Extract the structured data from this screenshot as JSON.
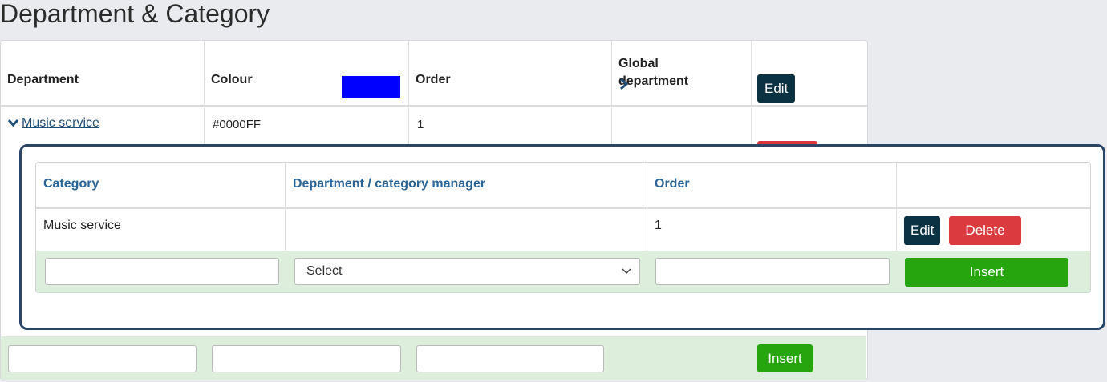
{
  "page": {
    "title": "Department & Category"
  },
  "departments_table": {
    "headers": {
      "department": "Department",
      "colour": "Colour",
      "order": "Order",
      "global_department_line1": "Global",
      "global_department_line2": "department"
    },
    "row": {
      "department": "Music service",
      "colour_hex": "#0000FF",
      "order": "1",
      "edit_label": "Edit"
    },
    "insert_label": "Insert"
  },
  "category_panel": {
    "headers": {
      "category": "Category",
      "manager": "Department / category manager",
      "order": "Order"
    },
    "row": {
      "category": "Music service",
      "manager": "",
      "order": "1",
      "edit_label": "Edit",
      "delete_label": "Delete"
    },
    "new_row": {
      "manager_select": "Select",
      "insert_label": "Insert"
    }
  },
  "colors": {
    "accent_dark": "#0b3242",
    "insert_green": "#27a50e",
    "delete_red": "#db3a3e",
    "popup_border": "#2a4566",
    "link": "#1f4e79"
  }
}
